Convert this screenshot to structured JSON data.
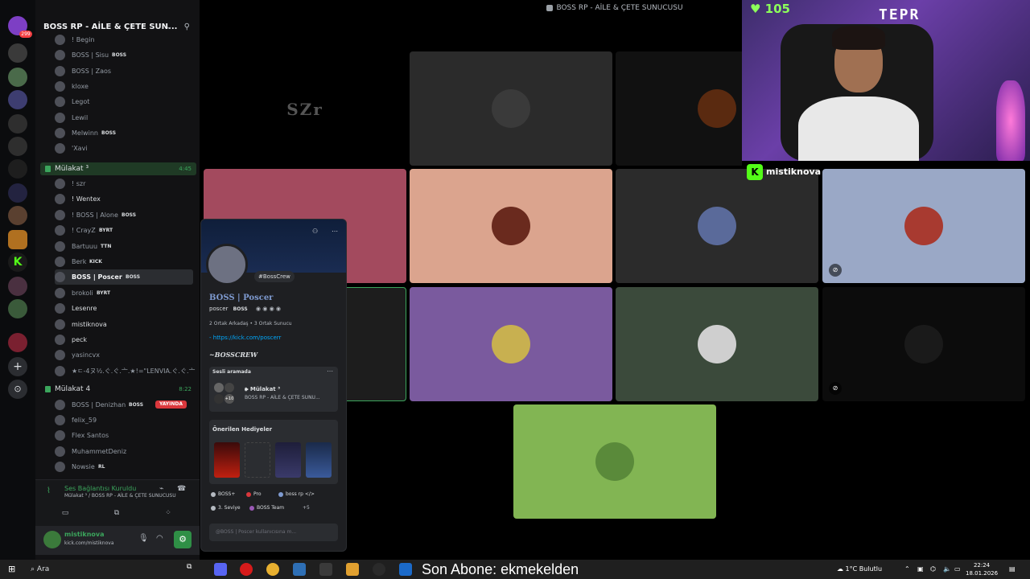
{
  "window": {
    "title": "BOSS RP - AİLE & ÇETE SUNUCUSU"
  },
  "server": {
    "name": "BOSS RP - AİLE & ÇETE SUN...",
    "badge_count": "299"
  },
  "channel_list": {
    "top_users": [
      {
        "name": "! Begin",
        "tag": ""
      },
      {
        "name": "BOSS | Sisu",
        "tag": "BOSS"
      },
      {
        "name": "BOSS | Zaos",
        "tag": ""
      },
      {
        "name": "kloxe",
        "tag": ""
      },
      {
        "name": "Legot",
        "tag": ""
      },
      {
        "name": "Lewil",
        "tag": ""
      },
      {
        "name": "Melwinn",
        "tag": "BOSS"
      },
      {
        "name": "'Xavi",
        "tag": ""
      }
    ],
    "vc1": {
      "name": "Mülakat ³",
      "time": "4:45",
      "users": [
        {
          "name": "! szr",
          "tag": ""
        },
        {
          "name": "! Wentex",
          "tag": ""
        },
        {
          "name": "! BOSS | Alone",
          "tag": "BOSS"
        },
        {
          "name": "! CrayZ",
          "tag": "BYRT"
        },
        {
          "name": "Bartuuu",
          "tag": "TTN"
        },
        {
          "name": "Berk",
          "tag": "KICK"
        },
        {
          "name": "BOSS | Poscer",
          "tag": "BOSS"
        },
        {
          "name": "brokoli",
          "tag": "BYRT"
        },
        {
          "name": "Lesenre",
          "tag": ""
        },
        {
          "name": "mistiknova",
          "tag": ""
        },
        {
          "name": "peck",
          "tag": ""
        },
        {
          "name": "yasincvx",
          "tag": ""
        },
        {
          "name": "★ㄷ-4ヌ½.ぐ.ぐ.亠.★!=\"LENVIA.ぐ.ぐ.亠",
          "tag": ""
        }
      ]
    },
    "vc2": {
      "name": "Mülakat 4",
      "time": "8:22",
      "users": [
        {
          "name": "BOSS | Denizhan",
          "tag": "BOSS"
        },
        {
          "name": "felix_59",
          "tag": ""
        },
        {
          "name": "Flex Santos",
          "tag": ""
        },
        {
          "name": "MuhammetDeniz",
          "tag": ""
        },
        {
          "name": "Nowsie",
          "tag": "RL"
        }
      ],
      "live_label": "YAYINDA"
    }
  },
  "voice_status": {
    "title": "Ses Bağlantısı Kuruldu",
    "subtitle": "Mülakat ³ / BOSS RP - AİLE & ÇETE SUNUCUSU"
  },
  "user_panel": {
    "name": "mistiknova",
    "status": "kick.com/mistiknova"
  },
  "video_grid": {
    "logo_text": "SZr"
  },
  "webcam": {
    "sub_count": "105",
    "neon": "TEPR",
    "streamer": "mistiknova"
  },
  "profile_popup": {
    "hashtag": "#BossCrew",
    "display_name": "BOSS | Poscer",
    "username": "poscer",
    "user_tag": "BOSS",
    "mutual": "2 Ortak Arkadaş  •  3 Ortak Sunucu",
    "link": "- https://kick.com/poscerr",
    "crew": "~BOSSCREW",
    "voice_card": {
      "header": "Sesli aramada",
      "channel": "🕪 Mülakat ³",
      "server": "BOSS RP - AİLE & ÇETE SUNU...",
      "extra": "+10"
    },
    "gifts_header": "Önerilen Hediyeler",
    "roles": [
      "BOSS+",
      "Pro",
      "boss rp </>",
      "3. Seviye",
      "BOSS Team",
      "+5"
    ],
    "message_placeholder": "@BOSS | Poscer kullanıcısına m..."
  },
  "taskbar": {
    "search": "Ara",
    "subscriber_text": "Son Abone: ekmekelden",
    "weather": "1°C  Bulutlu",
    "time": "22:24",
    "date": "18.01.2026"
  },
  "colors": {
    "accent_green": "#3ba55c",
    "live_red": "#da373c",
    "kick_green": "#53fc18"
  }
}
